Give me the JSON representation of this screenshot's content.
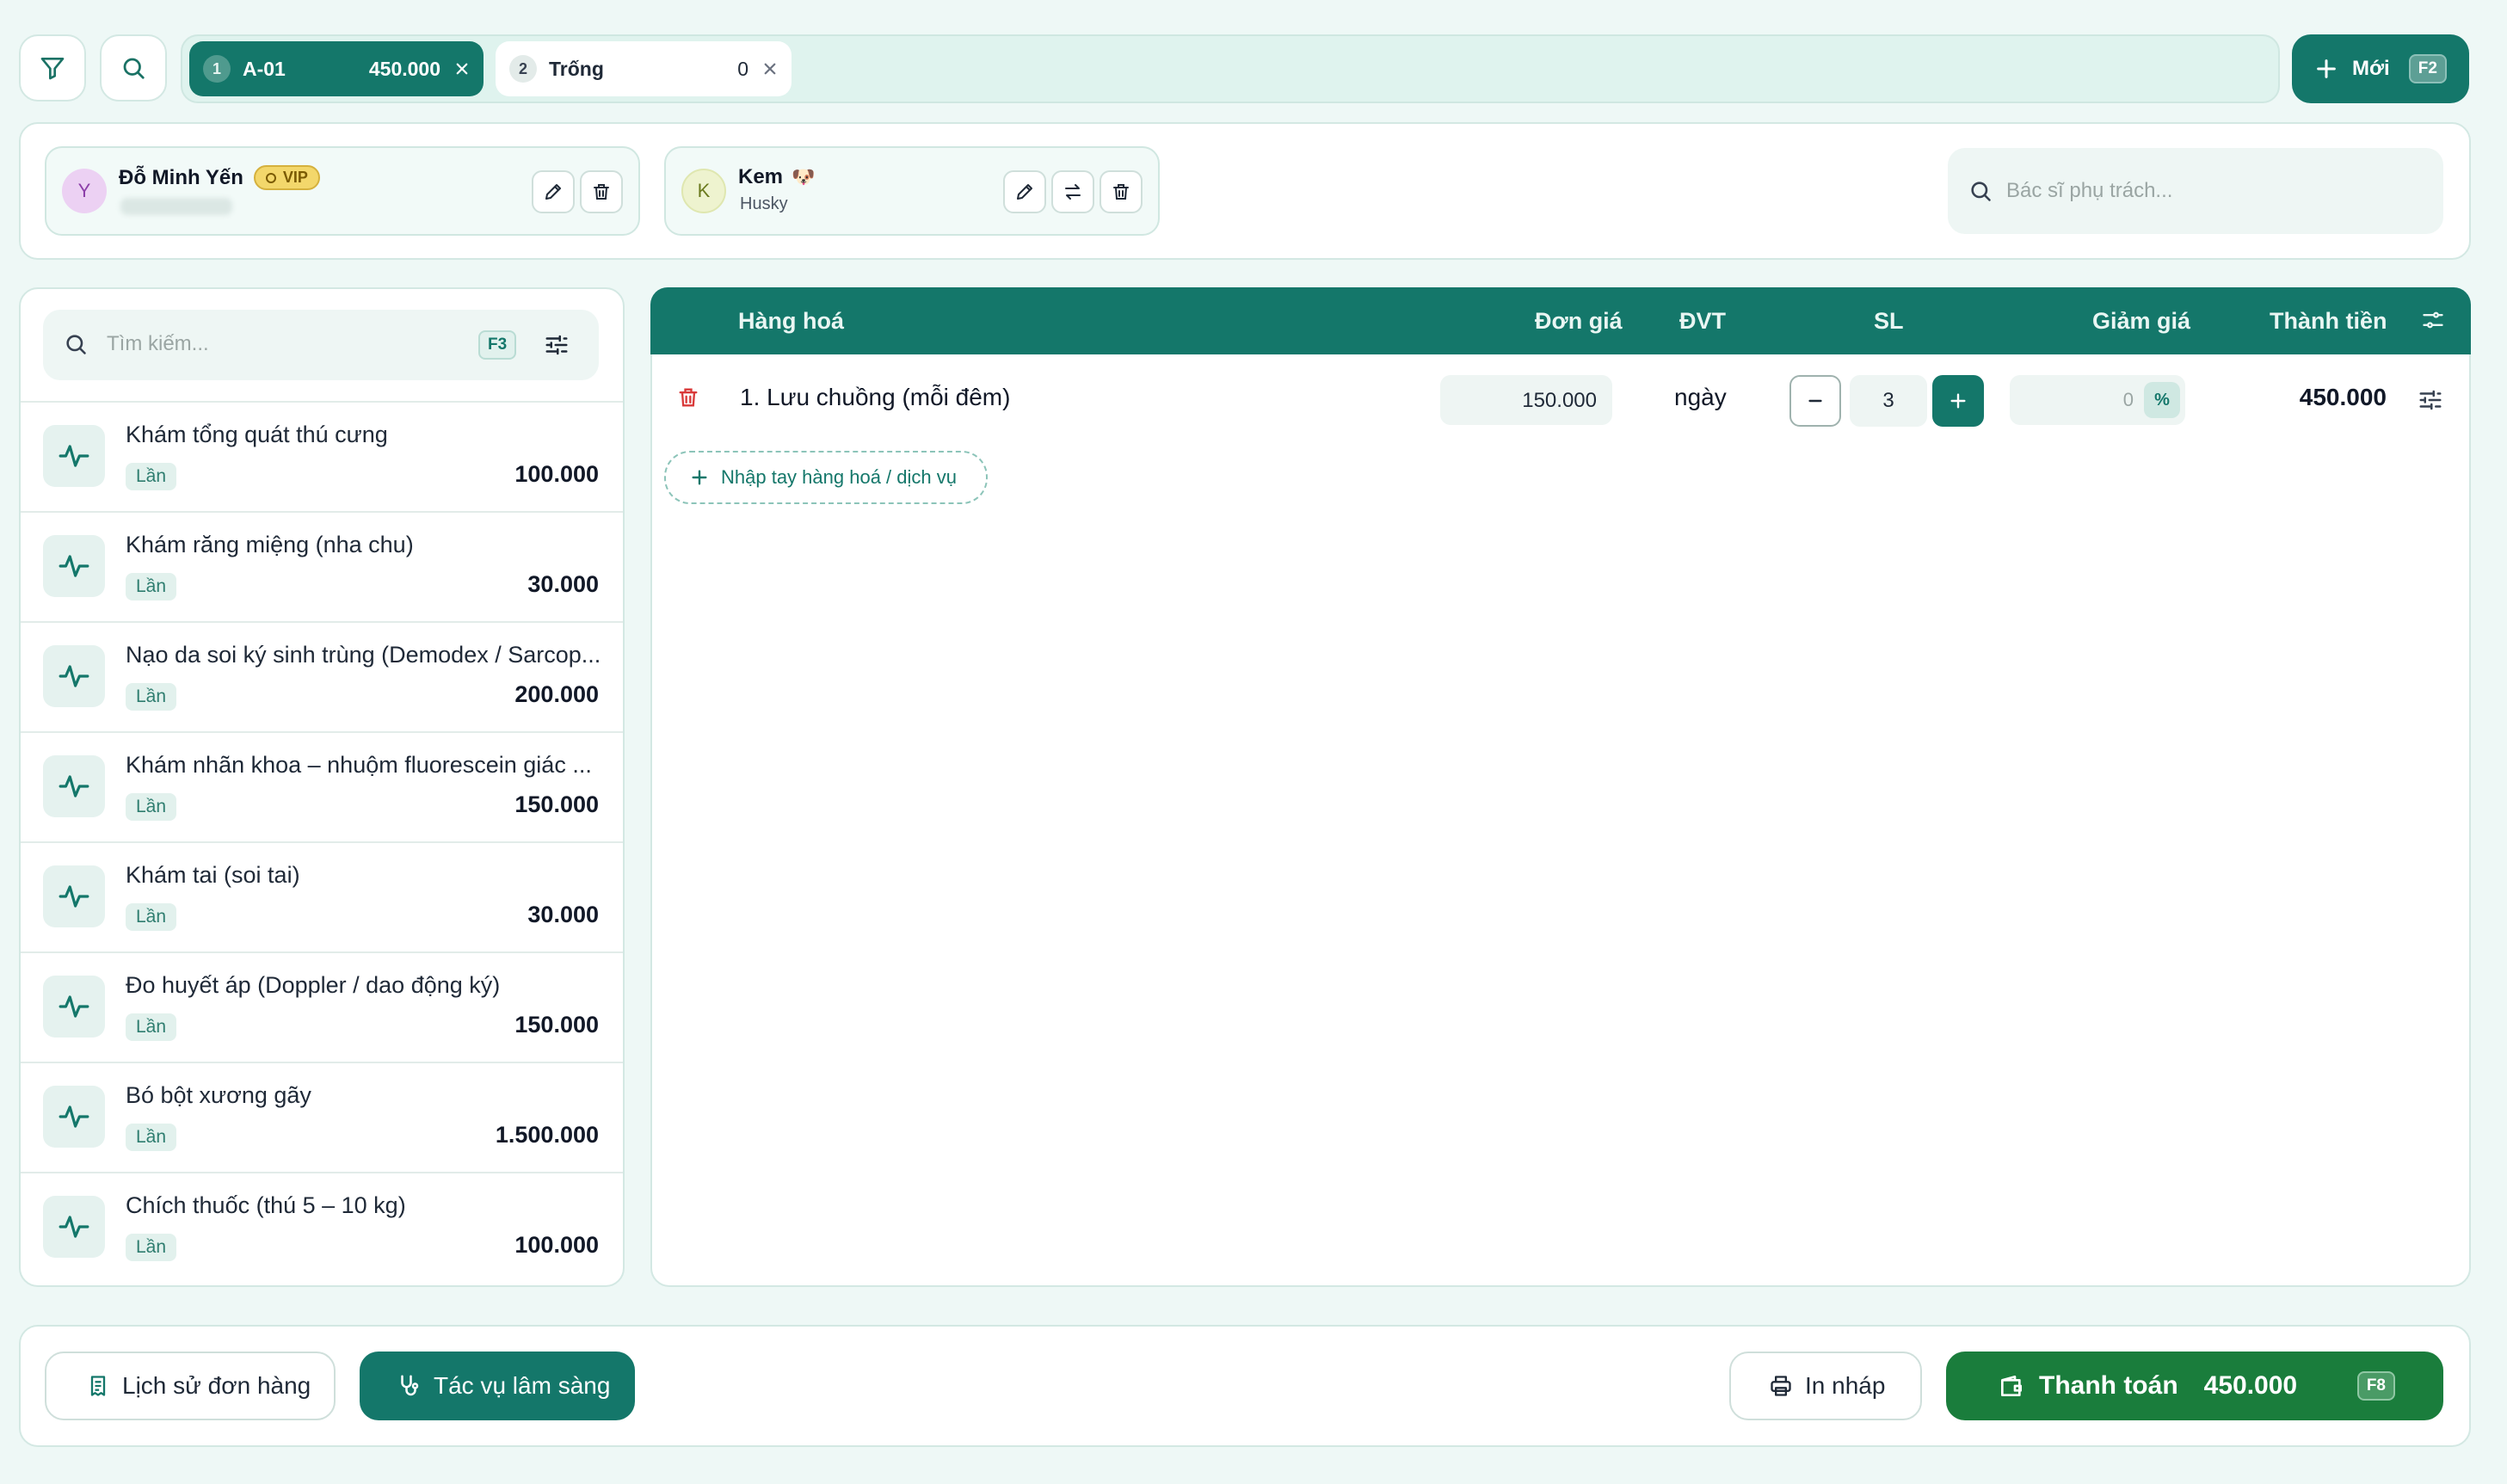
{
  "colors": {
    "primary": "#14776a",
    "pay": "#1a7d3c",
    "background": "#eef8f6",
    "danger": "#d93a3a"
  },
  "toolbar": {
    "filter_icon": "filter-icon",
    "search_icon": "search-icon"
  },
  "order_tabs": [
    {
      "number": "1",
      "name": "A-01",
      "amount": "450.000",
      "active": true
    },
    {
      "number": "2",
      "name": "Trống",
      "amount": "0",
      "active": false
    }
  ],
  "new_order": {
    "label": "Mới",
    "shortcut": "F2"
  },
  "customer": {
    "initial": "Y",
    "name": "Đỗ Minh Yến",
    "badge": "VIP"
  },
  "pet": {
    "initial": "K",
    "name": "Kem",
    "emoji": "🐶",
    "breed": "Husky"
  },
  "doctor_search": {
    "placeholder": "Bác sĩ phụ trách..."
  },
  "catalog": {
    "search_placeholder": "Tìm kiếm...",
    "shortcut": "F3",
    "items": [
      {
        "name": "Khám tổng quát thú cưng",
        "unit": "Lần",
        "price": "100.000"
      },
      {
        "name": "Khám răng miệng (nha chu)",
        "unit": "Lần",
        "price": "30.000"
      },
      {
        "name": "Nạo da soi ký sinh trùng (Demodex / Sarcop...",
        "unit": "Lần",
        "price": "200.000"
      },
      {
        "name": "Khám nhãn khoa – nhuộm fluorescein giác ...",
        "unit": "Lần",
        "price": "150.000"
      },
      {
        "name": "Khám tai (soi tai)",
        "unit": "Lần",
        "price": "30.000"
      },
      {
        "name": "Đo huyết áp (Doppler / dao động ký)",
        "unit": "Lần",
        "price": "150.000"
      },
      {
        "name": "Bó bột xương gãy",
        "unit": "Lần",
        "price": "1.500.000"
      },
      {
        "name": "Chích thuốc (thú 5 – 10 kg)",
        "unit": "Lần",
        "price": "100.000"
      }
    ]
  },
  "cart": {
    "headers": {
      "item": "Hàng hoá",
      "unit_price": "Đơn giá",
      "uom": "ĐVT",
      "qty": "SL",
      "discount": "Giảm giá",
      "total": "Thành tiền"
    },
    "lines": [
      {
        "name": "1. Lưu chuồng (mỗi đêm)",
        "unit_price": "150.000",
        "uom": "ngày",
        "qty": "3",
        "discount": "0",
        "discount_unit": "%",
        "total": "450.000"
      }
    ],
    "manual_add_label": "Nhập tay hàng hoá / dịch vụ"
  },
  "footer": {
    "history_label": "Lịch sử đơn hàng",
    "clinical_label": "Tác vụ lâm sàng",
    "print_label": "In nháp",
    "pay_label": "Thanh toán",
    "pay_amount": "450.000",
    "pay_shortcut": "F8"
  }
}
